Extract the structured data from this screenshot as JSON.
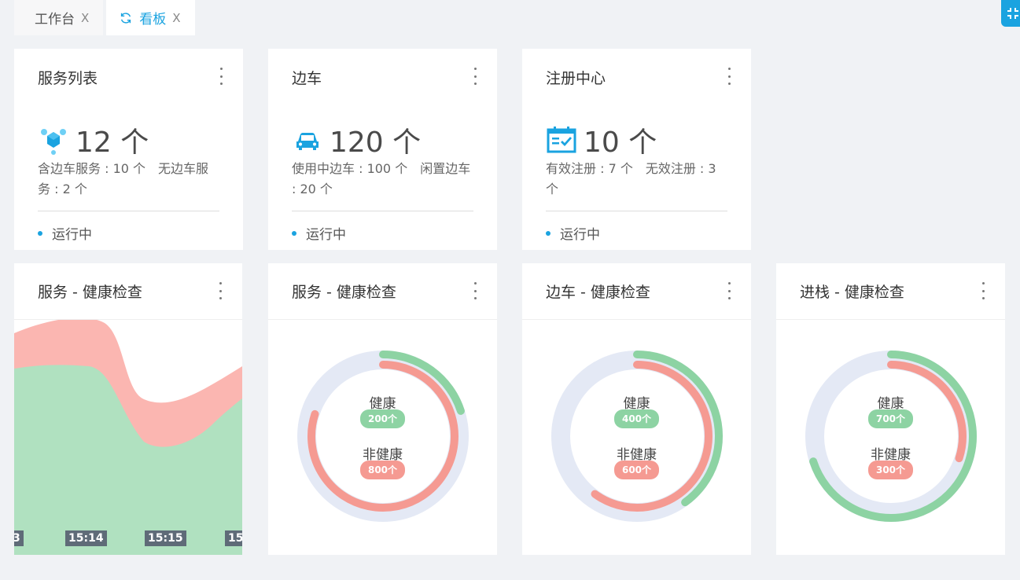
{
  "tabs": [
    {
      "label": "工作台",
      "close": "X"
    },
    {
      "label": "看板",
      "close": "X"
    }
  ],
  "summary_cards": [
    {
      "title": "服务列表",
      "count": "12 个",
      "desc": "含边车服务 : 10 个　无边车服务 : 2 个",
      "status": "运行中",
      "icon": "services-hexagon-icon"
    },
    {
      "title": "边车",
      "count": "120 个",
      "desc": "使用中边车 : 100 个　闲置边车 : 20 个",
      "status": "运行中",
      "icon": "car-icon"
    },
    {
      "title": "注册中心",
      "count": "10 个",
      "desc": "有效注册 : 7 个　无效注册 : 3 个",
      "status": "运行中",
      "icon": "calendar-check-icon"
    }
  ],
  "area_chart": {
    "title": "服务 - 健康检查",
    "ticks": [
      "3",
      "15:14",
      "15:15",
      "15"
    ]
  },
  "donut_cards": [
    {
      "title": "服务 - 健康检查",
      "healthy_label": "健康",
      "healthy_value": "200个",
      "unhealthy_label": "非健康",
      "unhealthy_value": "800个",
      "healthy_fraction": 0.2,
      "unhealthy_fraction": 0.8
    },
    {
      "title": "边车 - 健康检查",
      "healthy_label": "健康",
      "healthy_value": "400个",
      "unhealthy_label": "非健康",
      "unhealthy_value": "600个",
      "healthy_fraction": 0.4,
      "unhealthy_fraction": 0.6
    },
    {
      "title": "进栈 - 健康检查",
      "healthy_label": "健康",
      "healthy_value": "700个",
      "unhealthy_label": "非健康",
      "unhealthy_value": "300个",
      "healthy_fraction": 0.7,
      "unhealthy_fraction": 0.3
    }
  ],
  "colors": {
    "accent": "#1aa3e0",
    "healthy": "#8dd3a3",
    "unhealthy": "#f59a92",
    "track": "#e4e9f5"
  }
}
